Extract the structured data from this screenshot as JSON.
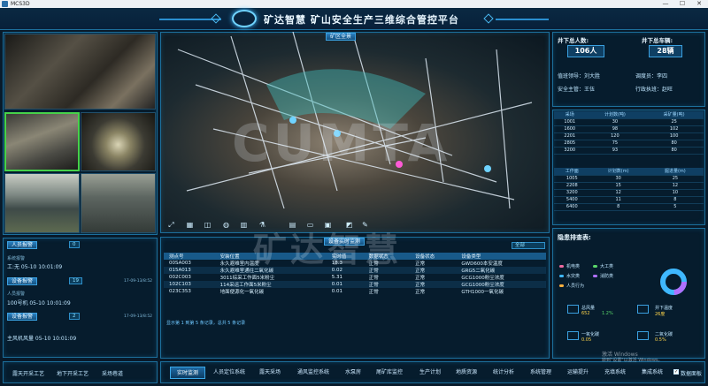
{
  "window": {
    "title": "MCS3D",
    "min": "—",
    "max": "☐",
    "close": "✕"
  },
  "header": {
    "title": "矿达智慧 矿山安全生产三维综合管控平台"
  },
  "scene": {
    "badge": "矿区全景"
  },
  "left_alerts": [
    {
      "label": "人员报警",
      "count": "0",
      "date": "17-09-13/8:52",
      "text": "工:无 05-10 10:01:09"
    },
    {
      "label": "设备报警",
      "count": "19",
      "date": "17-09-13/8:52",
      "text": "100号机 05-10 10:01:09"
    },
    {
      "label": "设备报警",
      "count": "2",
      "date": "17-09-13/8:52",
      "text": "主风机风量 05-10 10:01:09"
    }
  ],
  "left_extra": {
    "status_a": "系统报警",
    "status_b": "人员报警"
  },
  "right_top": {
    "down_people_label": "井下总人数:",
    "down_people_value": "106人",
    "down_cars_label": "井下总车辆:",
    "down_cars_value": "28辆",
    "leader_label": "值班领导：刘大胜",
    "dispatcher_label": "调度员：李四",
    "safety_label": "安全主管：王伍",
    "exec_label": "行政执班：赵旺"
  },
  "table1": {
    "headers": [
      "采场",
      "计划数(吨)",
      "采矿量(吨)"
    ],
    "rows": [
      [
        "1001",
        "30",
        "25"
      ],
      [
        "1600",
        "98",
        "102"
      ],
      [
        "2201",
        "120",
        "100"
      ],
      [
        "2805",
        "75",
        "80"
      ],
      [
        "3200",
        "93",
        "80"
      ]
    ]
  },
  "table2": {
    "headers": [
      "工作面",
      "计划数(m)",
      "掘进量(m)"
    ],
    "rows": [
      [
        "1005",
        "30",
        "25"
      ],
      [
        "2208",
        "15",
        "12"
      ],
      [
        "3200",
        "12",
        "10"
      ],
      [
        "5400",
        "11",
        "8"
      ],
      [
        "6400",
        "8",
        "5"
      ]
    ]
  },
  "safety_panel": {
    "title": "隐患排查表:",
    "legend": [
      {
        "label": "机电类",
        "color": "#f06aa0"
      },
      {
        "label": "大工类",
        "color": "#5ad66a"
      },
      {
        "label": "水灾类",
        "color": "#3fb8ff"
      },
      {
        "label": "消防类",
        "color": "#b070ff"
      },
      {
        "label": "人员行为",
        "color": "#ffb23f"
      }
    ],
    "stats": [
      {
        "label": "总风量",
        "value": "652",
        "delta": "1.2%"
      },
      {
        "label": "井下温度",
        "value": "26度",
        "delta": ""
      },
      {
        "label": "一氧化碳",
        "value": "0.05",
        "delta": ""
      },
      {
        "label": "二氧化碳",
        "value": "0.5%",
        "delta": ""
      }
    ]
  },
  "center_table": {
    "title": "设备实时监测",
    "select": "全部",
    "headers": [
      "测点号",
      "安装位置",
      "实时值",
      "数据状态",
      "设备状态",
      "设备类型"
    ],
    "rows": [
      [
        "00SA003",
        "永久避难室内温度",
        "18.3",
        "正常",
        "正常",
        "GWD600本安温度"
      ],
      [
        "015A013",
        "永久避难室通往二氧化碳",
        "0.02",
        "正常",
        "正常",
        "GRG5二氧化碳"
      ],
      [
        "002C003",
        "3011综采工作面5米粉尘",
        "5.31",
        "正常",
        "正常",
        "GCG1000粉尘浓度"
      ],
      [
        "102C103",
        "114采运工作面5米粉尘",
        "0.01",
        "正常",
        "正常",
        "GCG1000粉尘浓度"
      ],
      [
        "023C353",
        "地面便源化一氧化碳",
        "0.01",
        "正常",
        "正常",
        "GTH1000一氧化碳"
      ]
    ],
    "footer": "显示第 1 到第 5 条记录，总共 5 条记录"
  },
  "bottom_left": {
    "items": [
      "露天开采工艺",
      "地下开采工艺",
      "采场巷道"
    ]
  },
  "nav": {
    "items": [
      "实时监测",
      "人员定位系统",
      "露天采场",
      "通风监控系统",
      "水泵房",
      "尾矿库监控",
      "生产计划",
      "地质资源",
      "统计分析",
      "系统管理",
      "运输提升",
      "充填系统",
      "集成系统"
    ],
    "active": 0,
    "checkbox_label": "数据面板"
  },
  "toolbar": {
    "icons": [
      "expand-icon",
      "grid-icon",
      "layers-icon",
      "globe-icon",
      "building-icon",
      "flask-icon",
      "chart-icon",
      "ruler-icon",
      "image-icon",
      "edit-icon"
    ]
  },
  "watermark": {
    "top": "CUMTA",
    "bottom": "矿达智慧"
  },
  "win_activate": {
    "line1": "激活 Windows",
    "line2": "转到\"设置\"以激活 Windows。"
  },
  "colors": {
    "accent": "#2a8fd0",
    "panel_border": "#1c6f9c",
    "highlight": "#46d24a"
  }
}
